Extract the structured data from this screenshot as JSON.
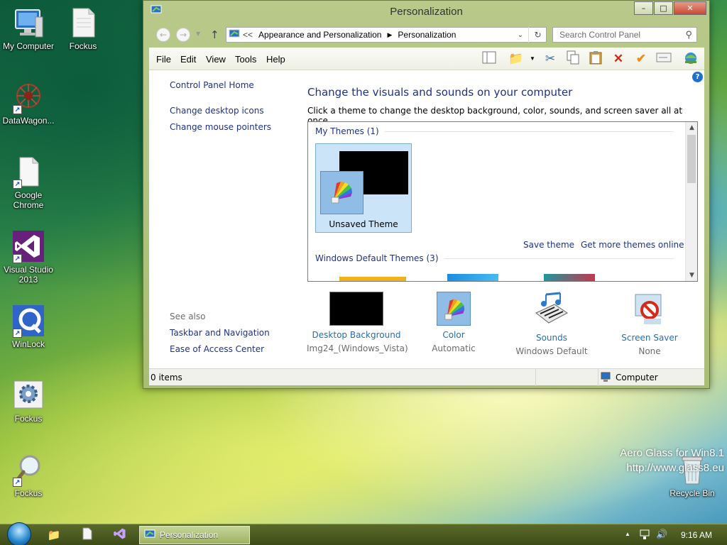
{
  "desktop": {
    "icons": [
      {
        "label": "My Computer",
        "icon": "computer-icon"
      },
      {
        "label": "Fockus",
        "icon": "document-icon"
      },
      {
        "label": "DataWagon...",
        "icon": "datawagon-icon"
      },
      {
        "label": "Google Chrome",
        "icon": "document-icon"
      },
      {
        "label": "Visual Studio 2013",
        "icon": "visual-studio-icon"
      },
      {
        "label": "WinLock",
        "icon": "winlock-icon"
      },
      {
        "label": "Fockus",
        "icon": "gear-icon"
      },
      {
        "label": "Fockus",
        "icon": "magnifier-icon"
      },
      {
        "label": "Recycle Bin",
        "icon": "recycle-bin-icon"
      }
    ],
    "watermark_line1": "Aero Glass for Win8.1",
    "watermark_line2": "http://www.glass8.eu"
  },
  "window": {
    "title": "Personalization",
    "controls": {
      "minimize": "–",
      "maximize": "□",
      "close": "✕"
    },
    "address": {
      "overflow": "<<",
      "crumbs": [
        "Appearance and Personalization",
        "Personalization"
      ],
      "search_placeholder": "Search Control Panel"
    },
    "menu": [
      "File",
      "Edit",
      "View",
      "Tools",
      "Help"
    ],
    "toolbar": [
      "layout-icon",
      "folder-icon",
      "cut-icon",
      "copy-icon",
      "paste-icon",
      "delete-icon",
      "check-icon",
      "properties-icon",
      "globe-icon"
    ],
    "left_nav": {
      "home": "Control Panel Home",
      "links": [
        "Change desktop icons",
        "Change mouse pointers"
      ],
      "see_also_heading": "See also",
      "see_also": [
        "Taskbar and Navigation",
        "Ease of Access Center"
      ]
    },
    "main": {
      "title": "Change the visuals and sounds on your computer",
      "subtitle": "Click a theme to change the desktop background, color, sounds, and screen saver all at once.",
      "my_themes_heading": "My Themes (1)",
      "theme_name": "Unsaved Theme",
      "save_theme": "Save theme",
      "get_more": "Get more themes online",
      "default_themes_heading": "Windows Default Themes (3)"
    },
    "bottom": [
      {
        "label": "Desktop Background",
        "value": "Img24_(Windows_Vista)"
      },
      {
        "label": "Color",
        "value": "Automatic"
      },
      {
        "label": "Sounds",
        "value": "Windows Default"
      },
      {
        "label": "Screen Saver",
        "value": "None"
      }
    ],
    "status": {
      "items": "0 items",
      "location": "Computer"
    }
  },
  "taskbar": {
    "active_app": "Personalization",
    "clock": "9:16 AM"
  },
  "colors": {
    "link": "#1e3287",
    "accent_link": "#1e6fb5",
    "selection": "#cce4f7"
  }
}
